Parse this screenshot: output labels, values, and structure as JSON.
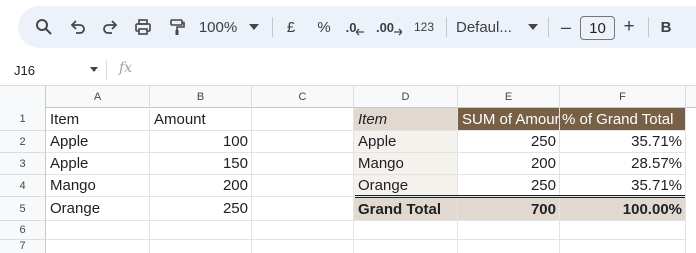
{
  "toolbar": {
    "zoom": "100%",
    "currency": "£",
    "percent": "%",
    "dec_decrease": ".0",
    "dec_increase": ".00",
    "number_format": "123",
    "font": "Defaul...",
    "font_size": "10",
    "bold": "B",
    "minus": "–",
    "plus": "+"
  },
  "formula_bar": {
    "name_box": "J16",
    "fx": "fx"
  },
  "columns": [
    "A",
    "B",
    "C",
    "D",
    "E",
    "F"
  ],
  "rows": [
    "1",
    "2",
    "3",
    "4",
    "5",
    "6",
    "7"
  ],
  "source_table": {
    "headers": [
      "Item",
      "Amount"
    ],
    "rows": [
      [
        "Apple",
        "100"
      ],
      [
        "Apple",
        "150"
      ],
      [
        "Mango",
        "200"
      ],
      [
        "Orange",
        "250"
      ]
    ]
  },
  "pivot": {
    "headers": [
      "Item",
      "SUM of Amour",
      "% of Grand Total"
    ],
    "rows": [
      [
        "Apple",
        "250",
        "35.71%"
      ],
      [
        "Mango",
        "200",
        "28.57%"
      ],
      [
        "Orange",
        "250",
        "35.71%"
      ]
    ],
    "total": [
      "Grand Total",
      "700",
      "100.00%"
    ]
  },
  "colors": {
    "pivot_header": "#786047",
    "pivot_total": "#e1d9cf",
    "toolbar_bg": "#edf2fa"
  }
}
